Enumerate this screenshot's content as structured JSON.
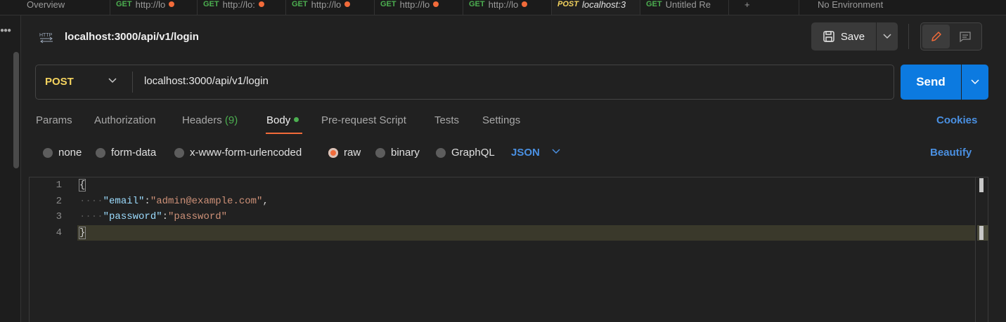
{
  "tabs": [
    {
      "method": "",
      "label": "Overview",
      "dot": false
    },
    {
      "method": "GET",
      "label": "http://lo",
      "dot": true
    },
    {
      "method": "GET",
      "label": "http://lo:",
      "dot": true
    },
    {
      "method": "GET",
      "label": "http://lo",
      "dot": true
    },
    {
      "method": "GET",
      "label": "http://lo",
      "dot": true
    },
    {
      "method": "GET",
      "label": "http://lo",
      "dot": true
    },
    {
      "method": "POST",
      "label": "localhost:3",
      "dot": false
    },
    {
      "method": "GET",
      "label": "Untitled Re",
      "dot": false
    },
    {
      "method": "",
      "label": "+",
      "dot": false
    },
    {
      "method": "",
      "label": "No Environment",
      "dot": false
    }
  ],
  "request": {
    "title": "localhost:3000/api/v1/login",
    "method": "POST",
    "url": "localhost:3000/api/v1/login"
  },
  "toolbar": {
    "save_label": "Save",
    "send_label": "Send"
  },
  "request_tabs": {
    "params": "Params",
    "authorization": "Authorization",
    "headers": "Headers",
    "headers_count": "(9)",
    "body": "Body",
    "pre_request": "Pre-request Script",
    "tests": "Tests",
    "settings": "Settings",
    "cookies": "Cookies"
  },
  "body_types": {
    "none": "none",
    "form_data": "form-data",
    "urlencoded": "x-www-form-urlencoded",
    "raw": "raw",
    "binary": "binary",
    "graphql": "GraphQL",
    "selected": "raw",
    "language": "JSON",
    "beautify": "Beautify"
  },
  "editor": {
    "line_numbers": [
      "1",
      "2",
      "3",
      "4"
    ],
    "open_brace": "{",
    "close_brace": "}",
    "indent": "····",
    "key1": "\"email\"",
    "val1": "\"admin@example.com\"",
    "key2": "\"password\"",
    "val2": "\"password\"",
    "colon": ":",
    "comma": ","
  },
  "colors": {
    "accent_orange": "#f26b3a",
    "send_blue": "#0c7ae0",
    "method_post": "#f4d35e",
    "method_get": "#4caf50",
    "link_blue": "#4a90e2"
  },
  "icons": [
    "http-icon",
    "save-icon",
    "chevron-down-icon",
    "pencil-icon",
    "comment-icon",
    "more-icon"
  ]
}
